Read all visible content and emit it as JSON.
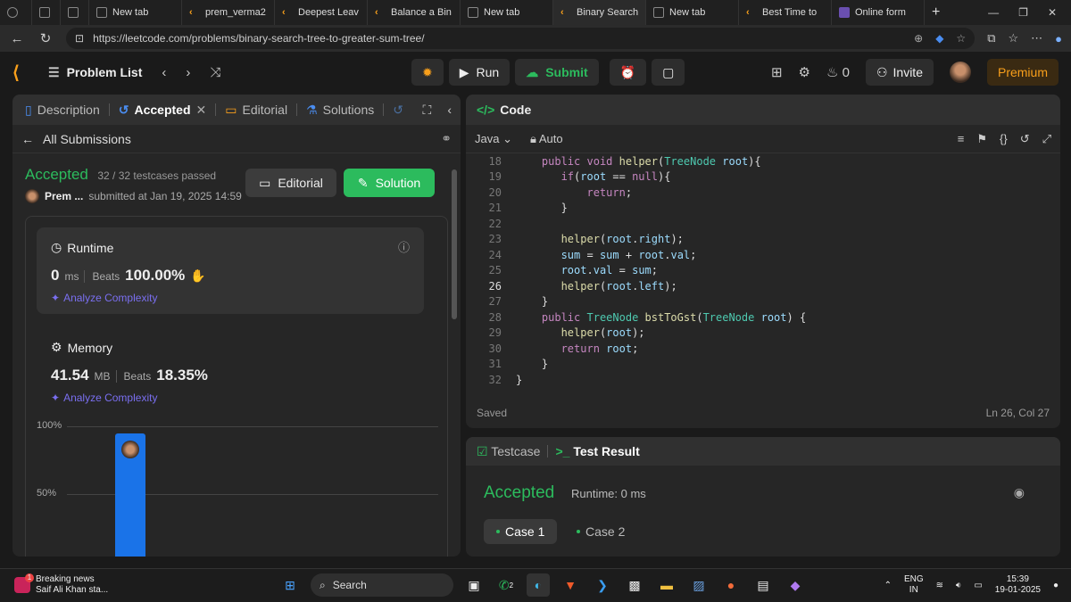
{
  "browser": {
    "tabs": [
      {
        "title": "New tab",
        "active": false
      },
      {
        "title": "prem_verma2",
        "active": false
      },
      {
        "title": "Deepest Leav",
        "active": false
      },
      {
        "title": "Balance a Bin",
        "active": false
      },
      {
        "title": "New tab",
        "active": false
      },
      {
        "title": "Binary Search",
        "active": true
      },
      {
        "title": "New tab",
        "active": false
      },
      {
        "title": "Best Time to",
        "active": false
      },
      {
        "title": "Online form",
        "active": false
      }
    ],
    "url": "https://leetcode.com/problems/binary-search-tree-to-greater-sum-tree/"
  },
  "header": {
    "problem_list": "Problem List",
    "run": "Run",
    "submit": "Submit",
    "streak": "0",
    "invite": "Invite",
    "premium": "Premium"
  },
  "left_panel": {
    "tabs": {
      "description": "Description",
      "accepted": "Accepted",
      "editorial": "Editorial",
      "solutions": "Solutions"
    },
    "all_submissions": "All Submissions",
    "status": "Accepted",
    "testcases": "32 / 32 testcases passed",
    "user": "Prem ...",
    "submitted_at": "submitted at Jan 19, 2025 14:59",
    "editorial_btn": "Editorial",
    "solution_btn": "Solution",
    "runtime": {
      "title": "Runtime",
      "value": "0",
      "unit": "ms",
      "beats_label": "Beats",
      "beats": "100.00%",
      "analyze": "Analyze Complexity"
    },
    "memory": {
      "title": "Memory",
      "value": "41.54",
      "unit": "MB",
      "beats_label": "Beats",
      "beats": "18.35%",
      "analyze": "Analyze Complexity"
    }
  },
  "chart_data": {
    "type": "bar",
    "y_ticks": [
      "100%",
      "50%"
    ],
    "ylim": [
      0,
      100
    ],
    "values": [
      95
    ],
    "highlight": "user"
  },
  "code_panel": {
    "title": "Code",
    "language": "Java",
    "mode": "Auto",
    "saved": "Saved",
    "cursor": "Ln 26, Col 27",
    "current_line": 26,
    "lines": [
      {
        "n": "18",
        "text": "    public void helper(TreeNode root){"
      },
      {
        "n": "19",
        "text": "       if(root == null){"
      },
      {
        "n": "20",
        "text": "           return;"
      },
      {
        "n": "21",
        "text": "       }"
      },
      {
        "n": "22",
        "text": ""
      },
      {
        "n": "23",
        "text": "       helper(root.right);"
      },
      {
        "n": "24",
        "text": "       sum = sum + root.val;"
      },
      {
        "n": "25",
        "text": "       root.val = sum;"
      },
      {
        "n": "26",
        "text": "       helper(root.left);"
      },
      {
        "n": "27",
        "text": "    }"
      },
      {
        "n": "28",
        "text": "    public TreeNode bstToGst(TreeNode root) {"
      },
      {
        "n": "29",
        "text": "       helper(root);"
      },
      {
        "n": "30",
        "text": "       return root;"
      },
      {
        "n": "31",
        "text": "    }"
      },
      {
        "n": "32",
        "text": "}"
      }
    ]
  },
  "test_panel": {
    "testcase_tab": "Testcase",
    "result_tab": "Test Result",
    "status": "Accepted",
    "runtime": "Runtime: 0 ms",
    "case1": "Case 1",
    "case2": "Case 2"
  },
  "taskbar": {
    "news_badge": "1",
    "news_title": "Breaking news",
    "news_sub": "Saif Ali Khan sta...",
    "search": "Search",
    "whatsapp_badge": "2",
    "lang": "ENG",
    "region": "IN",
    "time": "15:39",
    "date": "19-01-2025"
  },
  "colors": {
    "accent_green": "#2cbb5d",
    "leetcode_orange": "#f89f1b",
    "bar_blue": "#1a73e8",
    "analyze_purple": "#7a6ff0"
  }
}
